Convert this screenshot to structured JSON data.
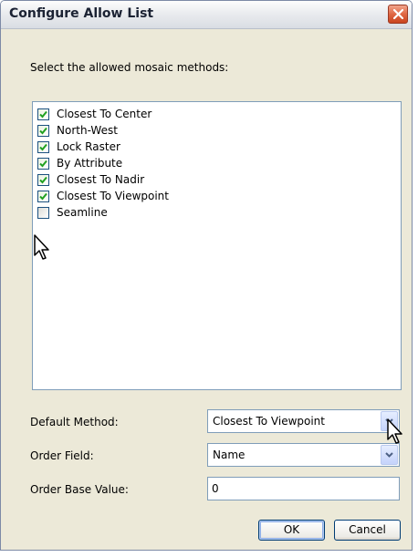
{
  "dialog": {
    "title": "Configure Allow List",
    "close_icon": "close-x-icon"
  },
  "prompt": "Select the allowed mosaic methods:",
  "methods": [
    {
      "label": "Closest To Center",
      "checked": true
    },
    {
      "label": "North-West",
      "checked": true
    },
    {
      "label": "Lock Raster",
      "checked": true
    },
    {
      "label": "By Attribute",
      "checked": true
    },
    {
      "label": "Closest To Nadir",
      "checked": true
    },
    {
      "label": "Closest To Viewpoint",
      "checked": true
    },
    {
      "label": "Seamline",
      "checked": false
    }
  ],
  "default_method": {
    "label": "Default Method:",
    "value": "Closest To Viewpoint"
  },
  "order_field": {
    "label": "Order Field:",
    "value": "Name"
  },
  "order_base_value": {
    "label": "Order Base Value:",
    "value": "0"
  },
  "buttons": {
    "ok": "OK",
    "cancel": "Cancel"
  },
  "colors": {
    "window_bg": "#ece9d8",
    "close_button": "#e06844",
    "check_mark": "#21a121",
    "field_border": "#7f9db9"
  }
}
